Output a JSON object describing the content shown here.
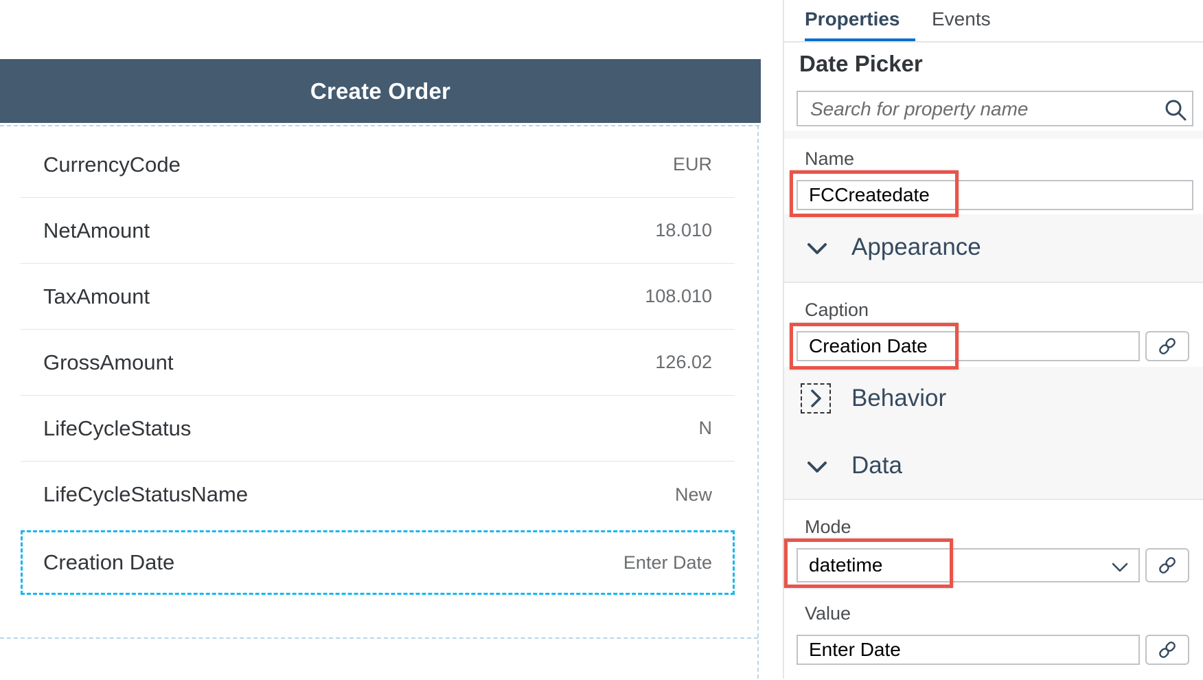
{
  "canvas": {
    "title": "Create Order",
    "rows": [
      {
        "label": "CurrencyCode",
        "value": "EUR"
      },
      {
        "label": "NetAmount",
        "value": "18.010"
      },
      {
        "label": "TaxAmount",
        "value": "108.010"
      },
      {
        "label": "GrossAmount",
        "value": "126.02"
      },
      {
        "label": "LifeCycleStatus",
        "value": "N"
      },
      {
        "label": "LifeCycleStatusName",
        "value": "New"
      },
      {
        "label": "Creation Date",
        "value": "Enter Date"
      }
    ]
  },
  "panel": {
    "tabs": {
      "properties": "Properties",
      "events": "Events"
    },
    "title": "Date Picker",
    "search_placeholder": "Search for property name",
    "name": {
      "label": "Name",
      "value": "FCCreatedate"
    },
    "appearance": {
      "label": "Appearance"
    },
    "caption": {
      "label": "Caption",
      "value": "Creation Date"
    },
    "behavior": {
      "label": "Behavior"
    },
    "data": {
      "label": "Data"
    },
    "mode": {
      "label": "Mode",
      "value": "datetime"
    },
    "value": {
      "label": "Value",
      "value": "Enter Date"
    }
  },
  "colors": {
    "header": "#445b70",
    "highlight": "#e9544a",
    "selection": "#16b8f0",
    "tab_accent": "#0a6ed1"
  },
  "icons": [
    "search-icon",
    "chevron-down-icon",
    "chevron-right-icon",
    "link-icon"
  ]
}
